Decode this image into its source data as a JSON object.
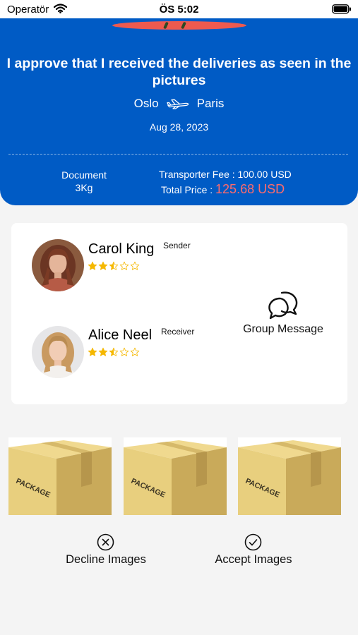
{
  "status_bar": {
    "carrier": "Operatör",
    "time": "ÖS 5:02"
  },
  "header": {
    "headline": "I approve that I received the deliveries as seen in the pictures",
    "origin": "Oslo",
    "destination": "Paris",
    "date": "Aug 28, 2023",
    "package_type": "Document",
    "package_weight": "3Kg",
    "fee_label": "Transporter Fee : 100.00 USD",
    "total_label": "Total Price :",
    "total_amount": "125.68 USD",
    "accent_color": "#005bc5",
    "total_color": "#ff6b6b"
  },
  "people": {
    "sender": {
      "name": "Carol King",
      "role": "Sender",
      "rating": 2.5,
      "max_rating": 5
    },
    "receiver": {
      "name": "Alice Neel",
      "role": "Receiver",
      "rating": 2.5,
      "max_rating": 5
    },
    "group_message_label": "Group Message",
    "star_color": "#f5b800"
  },
  "packages": [
    {
      "label": "PACKAGE"
    },
    {
      "label": "PACKAGE"
    },
    {
      "label": "PACKAGE"
    }
  ],
  "actions": {
    "decline_label": "Decline Images",
    "accept_label": "Accept Images"
  }
}
